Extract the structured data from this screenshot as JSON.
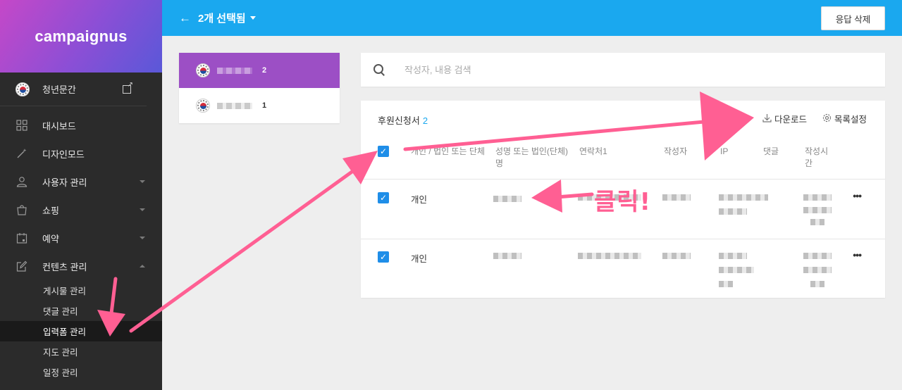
{
  "brand": "campaignus",
  "sidebar": {
    "site_name": "청년문간",
    "items": [
      {
        "label": "대시보드",
        "icon": "grid-icon"
      },
      {
        "label": "디자인모드",
        "icon": "wand-icon"
      },
      {
        "label": "사용자 관리",
        "icon": "user-icon"
      },
      {
        "label": "쇼핑",
        "icon": "bag-icon"
      },
      {
        "label": "예약",
        "icon": "calendar-icon"
      },
      {
        "label": "컨텐츠 관리",
        "icon": "edit-icon"
      }
    ],
    "sub_items": [
      "게시물 관리",
      "댓글 관리",
      "입력폼 관리",
      "지도 관리",
      "일정 관리"
    ]
  },
  "topbar": {
    "title": "2개 선택됨",
    "delete_label": "응답 삭제"
  },
  "forms": [
    {
      "count": "2"
    },
    {
      "count": "1"
    }
  ],
  "search": {
    "placeholder": "작성자, 내용 검색"
  },
  "table": {
    "title": "후원신청서",
    "count": "2",
    "download_label": "다운로드",
    "settings_label": "목록설정",
    "headers": [
      "개인 / 법인 또는 단체",
      "성명 또는 법인(단체)명",
      "연락처1",
      "작성자",
      "IP",
      "댓글",
      "작성시간"
    ],
    "rows": [
      {
        "type": "개인"
      },
      {
        "type": "개인"
      }
    ]
  },
  "annotation": {
    "label": "클릭!"
  },
  "colors": {
    "topbar": "#1aa8ef",
    "accent": "#9c4fc5",
    "annotation": "#ff5f93",
    "checkbox": "#1f8ee8"
  }
}
